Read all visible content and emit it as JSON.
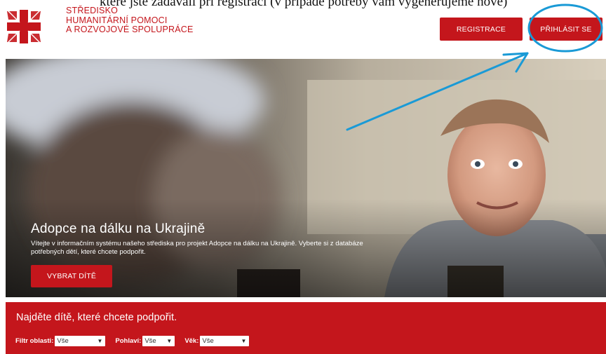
{
  "caption": "které jste zadávali při registraci (v případě potřeby vám vygenerujeme nové)",
  "header": {
    "org_name": [
      "STŘEDISKO",
      "HUMANITÁRNÍ POMOCI",
      "A ROZVOJOVÉ SPOLUPRÁCE"
    ],
    "register_label": "REGISTRACE",
    "login_label": "PŘIHLÁSIT SE"
  },
  "hero": {
    "title": "Adopce na dálku na Ukrajině",
    "description": "Vítejte v informačním systému našeho střediska pro projekt Adopce na dálku na Ukrajině. Vyberte si z databáze potřebných dětí, které chcete podpořit.",
    "cta_label": "VYBRAT DÍTĚ"
  },
  "search": {
    "title": "Najděte dítě, které chcete podpořit.",
    "filters": [
      {
        "label": "Filtr oblasti:",
        "value": "Vše"
      },
      {
        "label": "Pohlaví:",
        "value": "Vše"
      },
      {
        "label": "Věk:",
        "value": "Vše"
      }
    ]
  },
  "colors": {
    "brand_red": "#c4161c",
    "annotation_blue": "#1a9ad6"
  },
  "icons": {
    "logo": "caritas-cross-icon",
    "dropdown": "chevron-down-icon"
  }
}
